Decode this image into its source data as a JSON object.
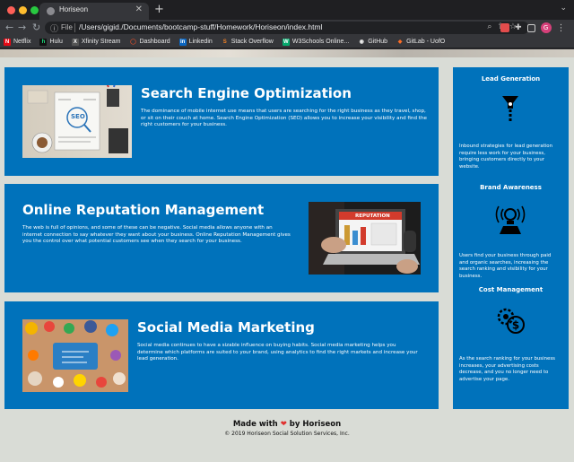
{
  "browser": {
    "tab_title": "Horiseon",
    "tab_close": "✕",
    "new_tab": "+",
    "url_scheme": "File",
    "url": "/Users/gigid./Documents/bootcamp-stuff/Homework/Horiseon/index.html",
    "avatar_letter": "G",
    "bookmarks": [
      {
        "label": "Netflix",
        "color": "#e50914",
        "glyph": "N"
      },
      {
        "label": "Hulu",
        "color": "#1ce783",
        "glyph": "h"
      },
      {
        "label": "Xfinity Stream",
        "color": "#6e6e6e",
        "glyph": "X"
      },
      {
        "label": "Dashboard",
        "color": "#d04b2a",
        "glyph": "◯"
      },
      {
        "label": "Linkedin",
        "color": "#0a66c2",
        "glyph": "in"
      },
      {
        "label": "Stack Overflow",
        "color": "#f48024",
        "glyph": "S"
      },
      {
        "label": "W3Schools Online...",
        "color": "#04aa6d",
        "glyph": "W"
      },
      {
        "label": "GitHub",
        "color": "#444444",
        "glyph": "◉"
      },
      {
        "label": "GitLab - UofO",
        "color": "#fc6d26",
        "glyph": "◆"
      }
    ]
  },
  "content": {
    "seo": {
      "title": "Search Engine Optimization",
      "body": "The dominance of mobile internet use means that users are searching for the right business as they travel, shop, or sit on their couch at home. Search Engine Optimization (SEO) allows you to increase your visibility and find the right customers for your business.",
      "image_text": "SEO"
    },
    "orm": {
      "title": "Online Reputation Management",
      "body": "The web is full of opinions, and some of these can be negative. Social media allows anyone with an internet connection to say whatever they want about your business. Online Reputation Management gives you the control over what potential customers see when they search for your business.",
      "image_text": "REPUTATION"
    },
    "smm": {
      "title": "Social Media Marketing",
      "body": "Social media continues to have a sizable influence on buying habits. Social media marketing helps you determine which platforms are suited to your brand, using analytics to find the right markets and increase your lead generation."
    }
  },
  "benefits": {
    "lead": {
      "title": "Lead Generation",
      "body": "Inbound strategies for lead generation require less work for your business, bringing customers directly to your website."
    },
    "brand": {
      "title": "Brand Awareness",
      "body": "Users find your business through paid and organic searches, increasing the search ranking and visibility for your business."
    },
    "cost": {
      "title": "Cost Management",
      "body": "As the search ranking for your business increases, your advertising costs decrease, and you no longer need to advertise your page."
    }
  },
  "footer": {
    "made_prefix": "Made with",
    "heart": "❤",
    "made_suffix": "by Horiseon",
    "copyright": "© 2019 Horiseon Social Solution Services, Inc."
  }
}
